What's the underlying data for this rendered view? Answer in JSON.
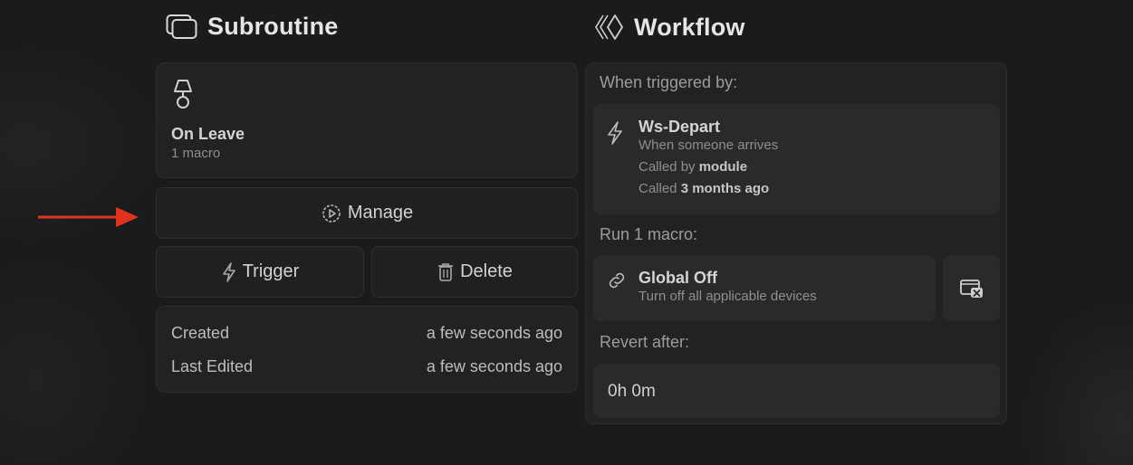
{
  "subroutine": {
    "title": "Subroutine",
    "icon": "windows-stack-icon",
    "card": {
      "icon": "lamp-icon",
      "name": "On Leave",
      "count": "1 macro"
    },
    "manage_label": "Manage",
    "trigger_label": "Trigger",
    "delete_label": "Delete",
    "meta": {
      "created_label": "Created",
      "created_value": "a few seconds ago",
      "edited_label": "Last Edited",
      "edited_value": "a few seconds ago"
    }
  },
  "workflow": {
    "title": "Workflow",
    "icon": "diamond-chevrons-icon",
    "trigger_header": "When triggered by:",
    "trigger": {
      "icon": "lightning-icon",
      "name": "Ws-Depart",
      "description": "When someone arrives",
      "called_by_prefix": "Called by ",
      "called_by": "module",
      "called_prefix": "Called ",
      "called_when": "3 months ago"
    },
    "run_header": "Run 1 macro:",
    "macro": {
      "icon": "link-icon",
      "name": "Global Off",
      "description": "Turn off all applicable devices",
      "remove_icon": "remove-window-icon"
    },
    "revert_header": "Revert after:",
    "revert_value": "0h 0m"
  },
  "annotation": {
    "color": "#e0341e"
  }
}
